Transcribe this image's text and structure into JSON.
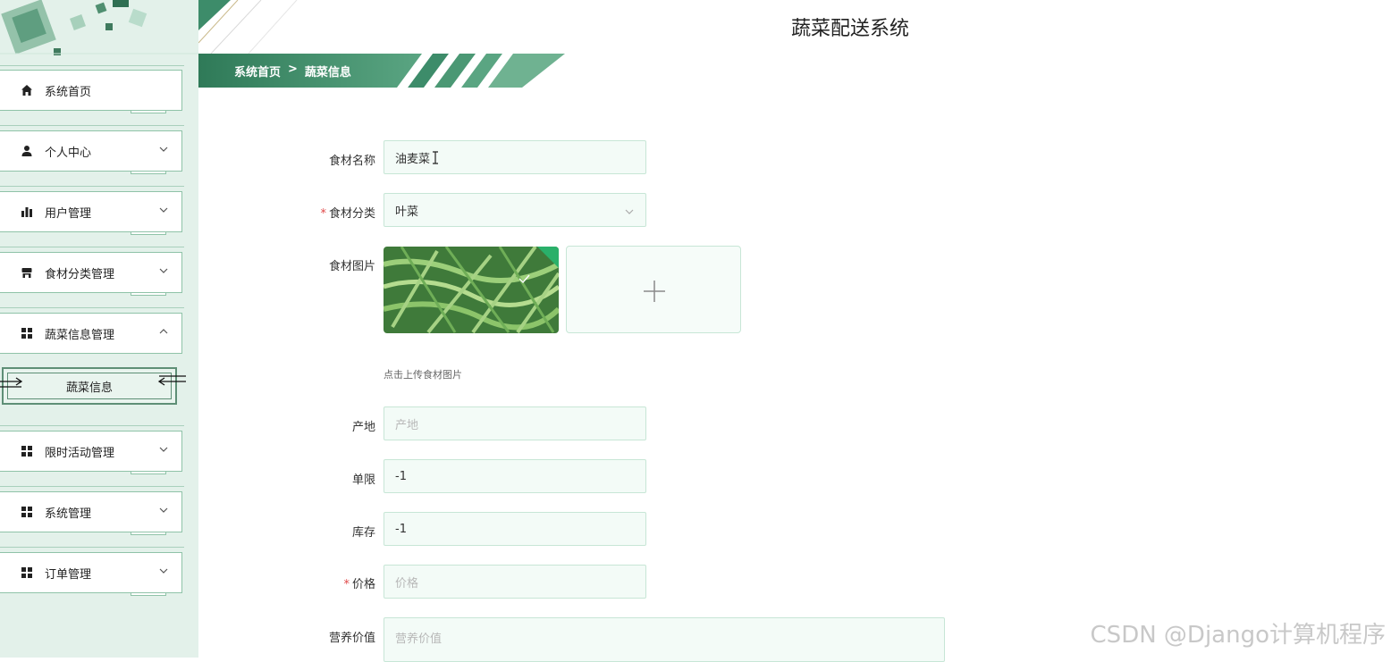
{
  "app": {
    "title": "蔬菜配送系统"
  },
  "breadcrumb": {
    "home": "系统首页",
    "separator": ">",
    "current": "蔬菜信息"
  },
  "sidebar": {
    "items": [
      {
        "label": "系统首页",
        "icon": "home-icon",
        "expandable": false
      },
      {
        "label": "个人中心",
        "icon": "user-icon",
        "expandable": true,
        "expanded": false
      },
      {
        "label": "用户管理",
        "icon": "bar-chart-icon",
        "expandable": true,
        "expanded": false
      },
      {
        "label": "食材分类管理",
        "icon": "store-icon",
        "expandable": true,
        "expanded": false
      },
      {
        "label": "蔬菜信息管理",
        "icon": "grid-icon",
        "expandable": true,
        "expanded": true
      },
      {
        "label": "限时活动管理",
        "icon": "grid-icon",
        "expandable": true,
        "expanded": false
      },
      {
        "label": "系统管理",
        "icon": "grid-icon",
        "expandable": true,
        "expanded": false
      },
      {
        "label": "订单管理",
        "icon": "grid-icon",
        "expandable": true,
        "expanded": false
      }
    ],
    "subitem": {
      "label": "蔬菜信息",
      "active": true
    }
  },
  "form": {
    "name": {
      "label": "食材名称",
      "value": "油麦菜",
      "required": false
    },
    "category": {
      "label": "食材分类",
      "value": "叶菜",
      "required": true
    },
    "image": {
      "label": "食材图片",
      "tip": "点击上传食材图片"
    },
    "origin": {
      "label": "产地",
      "placeholder": "产地"
    },
    "limit": {
      "label": "单限",
      "value": "-1"
    },
    "stock": {
      "label": "库存",
      "value": "-1"
    },
    "price": {
      "label": "价格",
      "placeholder": "价格",
      "required": true
    },
    "nutrition": {
      "label": "营养价值",
      "placeholder": "营养价值"
    }
  },
  "watermark": "CSDN @Django计算机程序",
  "colors": {
    "accent": "#3d8c6a",
    "sidebar_bg": "#e3f1ea",
    "field_border": "#c7e6d6",
    "required": "#e04848"
  }
}
